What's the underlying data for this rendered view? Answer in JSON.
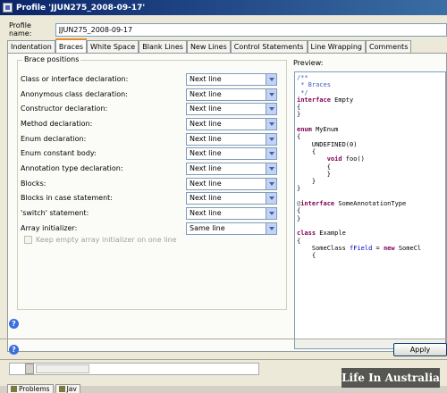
{
  "window": {
    "title": "Profile 'JJUN275_2008-09-17'"
  },
  "profile": {
    "label": "Profile name:",
    "value": "JJUN275_2008-09-17"
  },
  "tabs": [
    {
      "label": "Indentation",
      "active": false
    },
    {
      "label": "Braces",
      "active": true
    },
    {
      "label": "White Space",
      "active": false
    },
    {
      "label": "Blank Lines",
      "active": false
    },
    {
      "label": "New Lines",
      "active": false
    },
    {
      "label": "Control Statements",
      "active": false
    },
    {
      "label": "Line Wrapping",
      "active": false
    },
    {
      "label": "Comments",
      "active": false
    }
  ],
  "brace_positions": {
    "title": "Brace positions",
    "options": [
      {
        "label": "Class or interface declaration:",
        "value": "Next line"
      },
      {
        "label": "Anonymous class declaration:",
        "value": "Next line"
      },
      {
        "label": "Constructor declaration:",
        "value": "Next line"
      },
      {
        "label": "Method declaration:",
        "value": "Next line"
      },
      {
        "label": "Enum declaration:",
        "value": "Next line"
      },
      {
        "label": "Enum constant body:",
        "value": "Next line"
      },
      {
        "label": "Annotation type declaration:",
        "value": "Next line"
      },
      {
        "label": "Blocks:",
        "value": "Next line"
      },
      {
        "label": "Blocks in case statement:",
        "value": "Next line"
      },
      {
        "label": "'switch' statement:",
        "value": "Next line"
      },
      {
        "label": "Array initializer:",
        "value": "Same line"
      }
    ],
    "keep_empty_label": "Keep empty array initializer on one line",
    "keep_empty_checked": false
  },
  "preview": {
    "label": "Preview:",
    "lines": [
      [
        [
          "cm",
          "/**"
        ]
      ],
      [
        [
          "cm",
          " * Braces"
        ]
      ],
      [
        [
          "cm",
          " */"
        ]
      ],
      [
        [
          "kw",
          "interface"
        ],
        [
          "",
          " Empty"
        ]
      ],
      [
        [
          "",
          "{"
        ]
      ],
      [
        [
          "",
          "}"
        ]
      ],
      [
        [
          "",
          ""
        ]
      ],
      [
        [
          "kw",
          "enum"
        ],
        [
          "",
          " MyEnum"
        ]
      ],
      [
        [
          "",
          "{"
        ]
      ],
      [
        [
          "",
          "    UNDEFINED(0)"
        ]
      ],
      [
        [
          "",
          "    {"
        ]
      ],
      [
        [
          "",
          "        "
        ],
        [
          "kw",
          "void"
        ],
        [
          "",
          " foo()"
        ]
      ],
      [
        [
          "",
          "        {"
        ]
      ],
      [
        [
          "",
          "        }"
        ]
      ],
      [
        [
          "",
          "    }"
        ]
      ],
      [
        [
          "",
          "}"
        ]
      ],
      [
        [
          "",
          ""
        ]
      ],
      [
        [
          "an",
          "@"
        ],
        [
          "kw",
          "interface"
        ],
        [
          "",
          " SomeAnnotationType"
        ]
      ],
      [
        [
          "",
          "{"
        ]
      ],
      [
        [
          "",
          "}"
        ]
      ],
      [
        [
          "",
          ""
        ]
      ],
      [
        [
          "kw",
          "class"
        ],
        [
          "",
          " Example"
        ]
      ],
      [
        [
          "",
          "{"
        ]
      ],
      [
        [
          "",
          "    SomeClass "
        ],
        [
          "fld",
          "fField"
        ],
        [
          "",
          " = "
        ],
        [
          "kw",
          "new"
        ],
        [
          "",
          " SomeCl"
        ]
      ],
      [
        [
          "",
          "    {"
        ]
      ]
    ]
  },
  "buttons": {
    "apply": "Apply"
  },
  "views": [
    {
      "label": "Problems"
    },
    {
      "label": "Jav"
    }
  ],
  "watermark": "Life In Australia"
}
